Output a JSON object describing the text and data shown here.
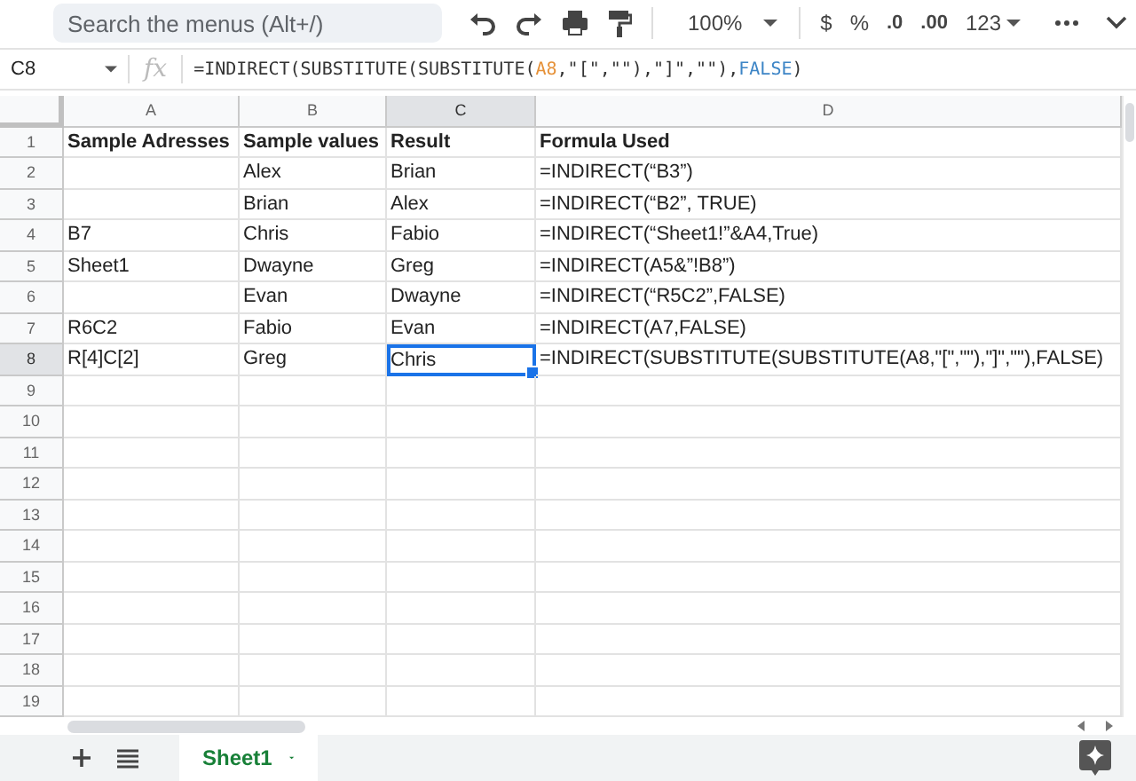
{
  "toolbar": {
    "search": {
      "placeholder": "Search the menus (Alt+/)"
    },
    "zoom": "100%",
    "currency": "$",
    "percent": "%",
    "decrease_decimals": ".0",
    "increase_decimals": ".00",
    "number_format": "123"
  },
  "formula_bar": {
    "name_box": "C8",
    "function_label": "fx",
    "formula": [
      {
        "kind": "text",
        "text": "=INDIRECT(SUBSTITUTE(SUBSTITUTE("
      },
      {
        "kind": "reference",
        "text": "A8"
      },
      {
        "kind": "text",
        "text": ",\"[\",\"\"),\"]\",\"\"),"
      },
      {
        "kind": "boolean",
        "text": "FALSE"
      },
      {
        "kind": "text",
        "text": ")"
      }
    ]
  },
  "grid": {
    "columns": [
      "A",
      "B",
      "C",
      "D"
    ],
    "rows": [
      {
        "number": "1",
        "cells": [
          {
            "text": "Sample Adresses",
            "bold": true,
            "selected": false
          },
          {
            "text": "Sample values",
            "bold": true,
            "selected": false
          },
          {
            "text": "Result",
            "bold": true,
            "selected": false
          },
          {
            "text": "Formula Used",
            "bold": true,
            "selected": false
          }
        ]
      },
      {
        "number": "2",
        "cells": [
          null,
          {
            "text": "Alex",
            "bold": false,
            "selected": false
          },
          {
            "text": "Brian",
            "bold": false,
            "selected": false
          },
          {
            "text": " =INDIRECT(“B3”)",
            "bold": false,
            "selected": false
          }
        ]
      },
      {
        "number": "3",
        "cells": [
          null,
          {
            "text": "Brian",
            "bold": false,
            "selected": false
          },
          {
            "text": "Alex",
            "bold": false,
            "selected": false
          },
          {
            "text": " =INDIRECT(“B2”, TRUE)",
            "bold": false,
            "selected": false
          }
        ]
      },
      {
        "number": "4",
        "cells": [
          {
            "text": "B7",
            "bold": false,
            "selected": false
          },
          {
            "text": "Chris",
            "bold": false,
            "selected": false
          },
          {
            "text": "Fabio",
            "bold": false,
            "selected": false
          },
          {
            "text": " =INDIRECT(“Sheet1!”&A4,True)",
            "bold": false,
            "selected": false
          }
        ]
      },
      {
        "number": "5",
        "cells": [
          {
            "text": "Sheet1",
            "bold": false,
            "selected": false
          },
          {
            "text": "Dwayne",
            "bold": false,
            "selected": false
          },
          {
            "text": "Greg",
            "bold": false,
            "selected": false
          },
          {
            "text": " =INDIRECT(A5&”!B8”)",
            "bold": false,
            "selected": false
          }
        ]
      },
      {
        "number": "6",
        "cells": [
          null,
          {
            "text": "Evan",
            "bold": false,
            "selected": false
          },
          {
            "text": "Dwayne",
            "bold": false,
            "selected": false
          },
          {
            "text": " =INDIRECT(“R5C2”,FALSE)",
            "bold": false,
            "selected": false
          }
        ]
      },
      {
        "number": "7",
        "cells": [
          {
            "text": "R6C2",
            "bold": false,
            "selected": false
          },
          {
            "text": "Fabio",
            "bold": false,
            "selected": false
          },
          {
            "text": "Evan",
            "bold": false,
            "selected": false
          },
          {
            "text": " =INDIRECT(A7,FALSE)",
            "bold": false,
            "selected": false
          }
        ]
      },
      {
        "number": "8",
        "cells": [
          {
            "text": "R[4]C[2]",
            "bold": false,
            "selected": false
          },
          {
            "text": "Greg",
            "bold": false,
            "selected": false
          },
          {
            "text": "Chris",
            "bold": false,
            "selected": true
          },
          {
            "text": " =INDIRECT(SUBSTITUTE(SUBSTITUTE(A8,\"[\",\"\"),\"]\",\"\"),FALSE)",
            "bold": false,
            "selected": false
          }
        ]
      },
      {
        "number": "9",
        "cells": []
      },
      {
        "number": "10",
        "cells": []
      },
      {
        "number": "11",
        "cells": []
      },
      {
        "number": "12",
        "cells": []
      },
      {
        "number": "13",
        "cells": []
      },
      {
        "number": "14",
        "cells": []
      },
      {
        "number": "15",
        "cells": []
      },
      {
        "number": "16",
        "cells": []
      },
      {
        "number": "17",
        "cells": []
      },
      {
        "number": "18",
        "cells": []
      },
      {
        "number": "19",
        "cells": []
      }
    ]
  },
  "sheet_tabs": [
    {
      "label": "Sheet1",
      "selected": true
    }
  ]
}
